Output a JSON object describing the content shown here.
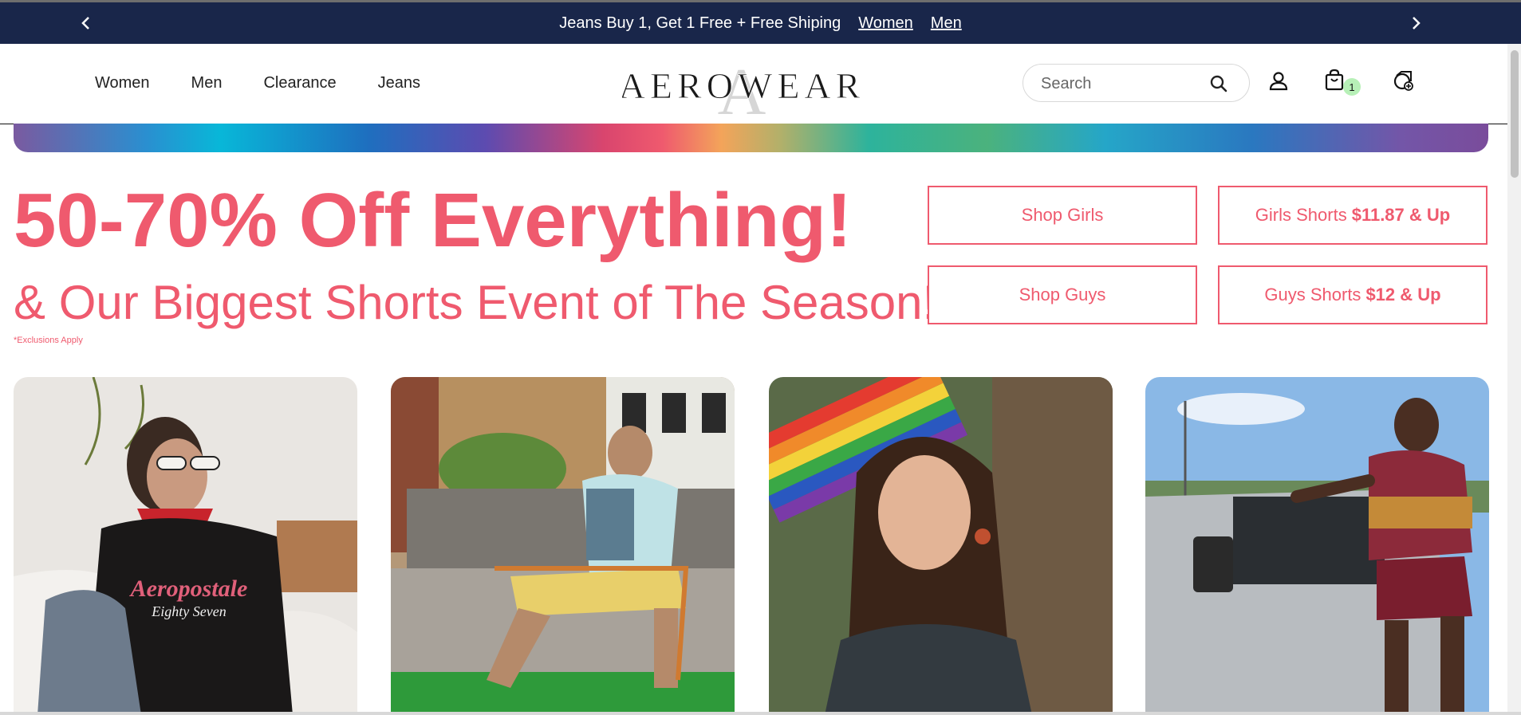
{
  "promo": {
    "message": "Jeans Buy 1, Get 1 Free + Free Shiping",
    "link_women": "Women",
    "link_men": "Men",
    "background": "#19264a"
  },
  "nav": {
    "items": [
      "Women",
      "Men",
      "Clearance",
      "Jeans"
    ]
  },
  "logo": {
    "text": "AEROWEAR",
    "monogram": "A"
  },
  "search": {
    "placeholder": "Search"
  },
  "icons": [
    "search-icon",
    "account-icon",
    "shopping-bag-icon",
    "rewards-icon",
    "chevron-left-icon",
    "chevron-right-icon"
  ],
  "cart": {
    "count": "1"
  },
  "hero": {
    "headline": "50-70% Off Everything!",
    "subhead": "& Our Biggest Shorts Event of The Season!",
    "exclusions": "*Exclusions Apply",
    "accent_color": "#ef5a6e"
  },
  "buttons": {
    "shop_girls": "Shop Girls",
    "shop_guys": "Shop Guys",
    "girls_shorts_label": "Girls Shorts",
    "girls_shorts_price": "$11.87 & Up",
    "guys_shorts_label": "Guys Shorts",
    "guys_shorts_price": "$12 & Up"
  },
  "photos": {
    "shirt_logo_line1": "Aeropostale",
    "shirt_logo_line2": "Eighty Seven"
  }
}
